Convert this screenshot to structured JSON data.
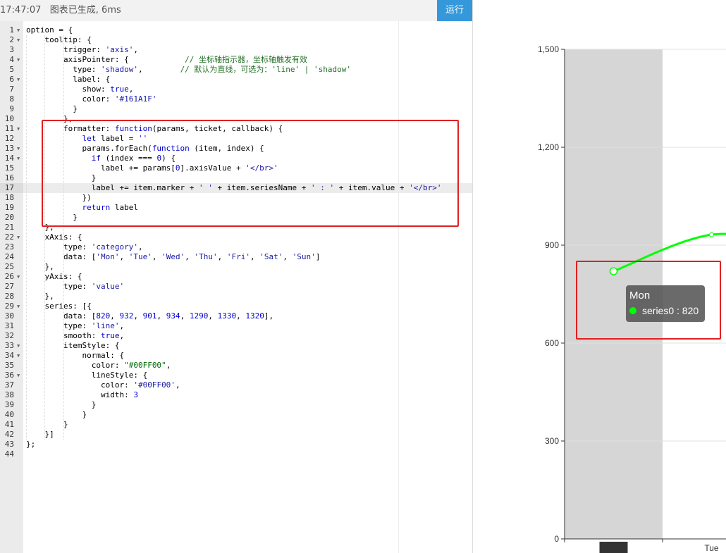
{
  "toolbar": {
    "status": "17:47:07   图表已生成, 6ms",
    "run_label": "运行"
  },
  "editor": {
    "active_line": 17,
    "lines": [
      {
        "n": 1,
        "fold": true,
        "t": "option = {"
      },
      {
        "n": 2,
        "fold": true,
        "t": "    tooltip: {"
      },
      {
        "n": 3,
        "fold": false,
        "t": "        trigger: 'axis',"
      },
      {
        "n": 4,
        "fold": true,
        "t": "        axisPointer: {            // 坐标轴指示器，坐标轴触发有效"
      },
      {
        "n": 5,
        "fold": false,
        "t": "          type: 'shadow',        // 默认为直线，可选为：'line' | 'shadow'"
      },
      {
        "n": 6,
        "fold": true,
        "t": "          label: {"
      },
      {
        "n": 7,
        "fold": false,
        "t": "            show: true,"
      },
      {
        "n": 8,
        "fold": false,
        "t": "            color: '#161A1F'"
      },
      {
        "n": 9,
        "fold": false,
        "t": "          }"
      },
      {
        "n": 10,
        "fold": false,
        "t": "        },"
      },
      {
        "n": 11,
        "fold": true,
        "t": "        formatter: function(params, ticket, callback) {"
      },
      {
        "n": 12,
        "fold": false,
        "t": "            let label = ''"
      },
      {
        "n": 13,
        "fold": true,
        "t": "            params.forEach(function (item, index) {"
      },
      {
        "n": 14,
        "fold": true,
        "t": "              if (index === 0) {"
      },
      {
        "n": 15,
        "fold": false,
        "t": "                label += params[0].axisValue + '</br>'"
      },
      {
        "n": 16,
        "fold": false,
        "t": "              }"
      },
      {
        "n": 17,
        "fold": false,
        "t": "              label += item.marker + ' ' + item.seriesName + ' : ' + item.value + '</br>'"
      },
      {
        "n": 18,
        "fold": false,
        "t": "            })"
      },
      {
        "n": 19,
        "fold": false,
        "t": "            return label"
      },
      {
        "n": 20,
        "fold": false,
        "t": "          }"
      },
      {
        "n": 21,
        "fold": false,
        "t": "    },"
      },
      {
        "n": 22,
        "fold": true,
        "t": "    xAxis: {"
      },
      {
        "n": 23,
        "fold": false,
        "t": "        type: 'category',"
      },
      {
        "n": 24,
        "fold": false,
        "t": "        data: ['Mon', 'Tue', 'Wed', 'Thu', 'Fri', 'Sat', 'Sun']"
      },
      {
        "n": 25,
        "fold": false,
        "t": "    },"
      },
      {
        "n": 26,
        "fold": true,
        "t": "    yAxis: {"
      },
      {
        "n": 27,
        "fold": false,
        "t": "        type: 'value'"
      },
      {
        "n": 28,
        "fold": false,
        "t": "    },"
      },
      {
        "n": 29,
        "fold": true,
        "t": "    series: [{"
      },
      {
        "n": 30,
        "fold": false,
        "t": "        data: [820, 932, 901, 934, 1290, 1330, 1320],"
      },
      {
        "n": 31,
        "fold": false,
        "t": "        type: 'line',"
      },
      {
        "n": 32,
        "fold": false,
        "t": "        smooth: true,"
      },
      {
        "n": 33,
        "fold": true,
        "t": "        itemStyle: {"
      },
      {
        "n": 34,
        "fold": true,
        "t": "            normal: {"
      },
      {
        "n": 35,
        "fold": false,
        "t": "              color: \"#00FF00\","
      },
      {
        "n": 36,
        "fold": true,
        "t": "              lineStyle: {"
      },
      {
        "n": 37,
        "fold": false,
        "t": "                color: '#00FF00',"
      },
      {
        "n": 38,
        "fold": false,
        "t": "                width: 3"
      },
      {
        "n": 39,
        "fold": false,
        "t": "              }"
      },
      {
        "n": 40,
        "fold": false,
        "t": "            }"
      },
      {
        "n": 41,
        "fold": false,
        "t": "        }"
      },
      {
        "n": 42,
        "fold": false,
        "t": "    }]"
      },
      {
        "n": 43,
        "fold": false,
        "t": "};"
      },
      {
        "n": 44,
        "fold": false,
        "t": ""
      }
    ]
  },
  "chart_data": {
    "type": "line",
    "categories": [
      "Mon",
      "Tue",
      "Wed",
      "Thu",
      "Fri",
      "Sat",
      "Sun"
    ],
    "visible_categories": [
      "Mon",
      "Tue"
    ],
    "series": [
      {
        "name": "series0",
        "values": [
          820,
          932,
          901,
          934,
          1290,
          1330,
          1320
        ]
      }
    ],
    "y_ticks": [
      "0",
      "300",
      "600",
      "900",
      "1,200",
      "1,500"
    ],
    "ylim": [
      0,
      1500
    ],
    "line_color": "#00FF00",
    "axis_pointer": "shadow",
    "highlighted_category": "Mon",
    "smooth": true,
    "grid": true
  },
  "tooltip": {
    "title": "Mon",
    "text": "series0 : 820",
    "marker_color": "#00FF00"
  }
}
